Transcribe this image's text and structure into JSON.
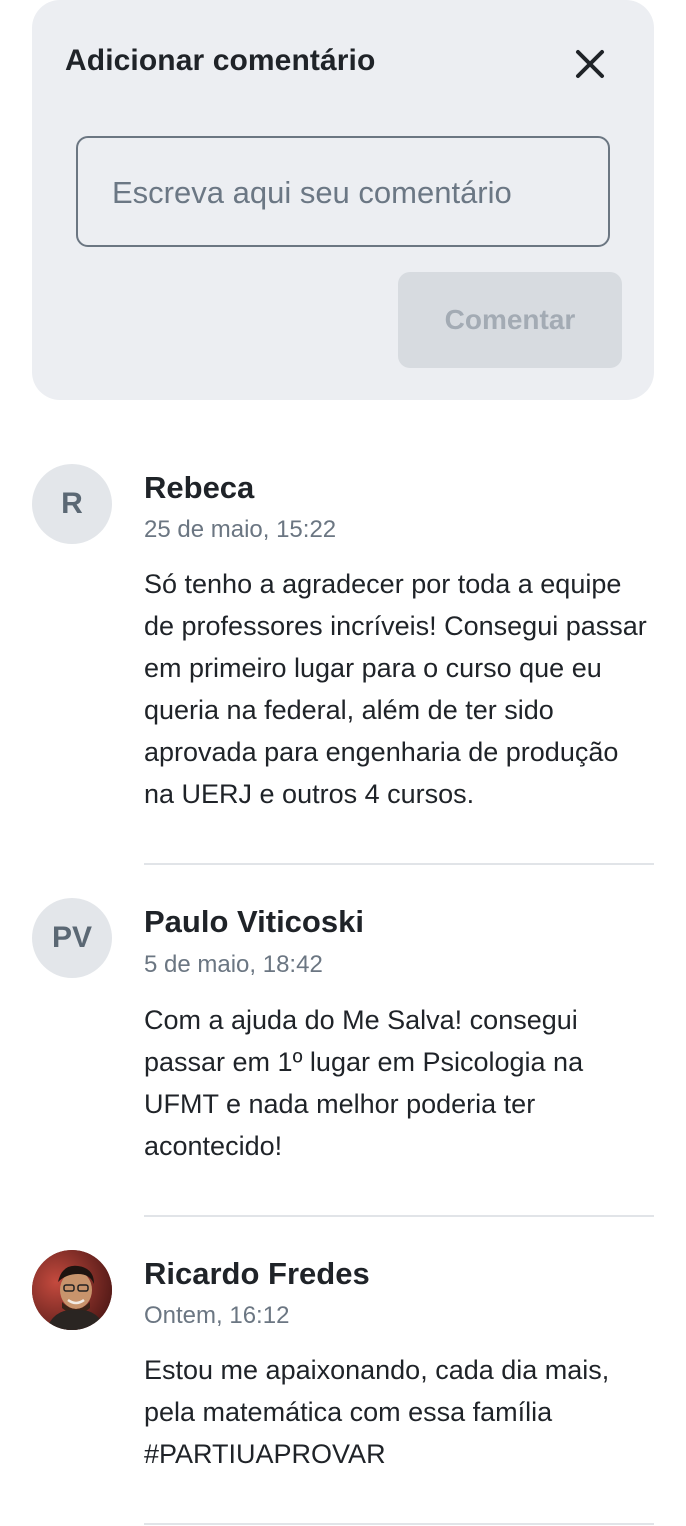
{
  "add_comment": {
    "title": "Adicionar comentário",
    "placeholder": "Escreva aqui seu comentário",
    "submit_label": "Comentar",
    "close_icon": "close-icon"
  },
  "comments": [
    {
      "author": "Rebeca",
      "initials": "R",
      "date": "25 de maio, 15:22",
      "text": "Só tenho a agradecer por toda a equipe de professores incríveis! Consegui passar em primeiro lugar para o curso que eu queria na federal, além de ter sido aprovada para engenharia de produção na UERJ e outros 4 cursos."
    },
    {
      "author": "Paulo Viticoski",
      "initials": "PV",
      "date": "5 de maio, 18:42",
      "text": "Com a ajuda do Me Salva! consegui passar em 1º lugar em Psicologia na UFMT e nada melhor poderia ter acontecido!"
    },
    {
      "author": "Ricardo Fredes",
      "date": "Ontem, 16:12",
      "text": "Estou me apaixonando, cada dia mais, pela matemática com essa família #PARTIUAPROVAR"
    }
  ],
  "colors": {
    "card_background": "#eceef2",
    "button_disabled_bg": "#d7dbe0",
    "button_disabled_text": "#a3abb4",
    "avatar_background": "#e3e6ea",
    "meta_text": "#6b7682"
  }
}
